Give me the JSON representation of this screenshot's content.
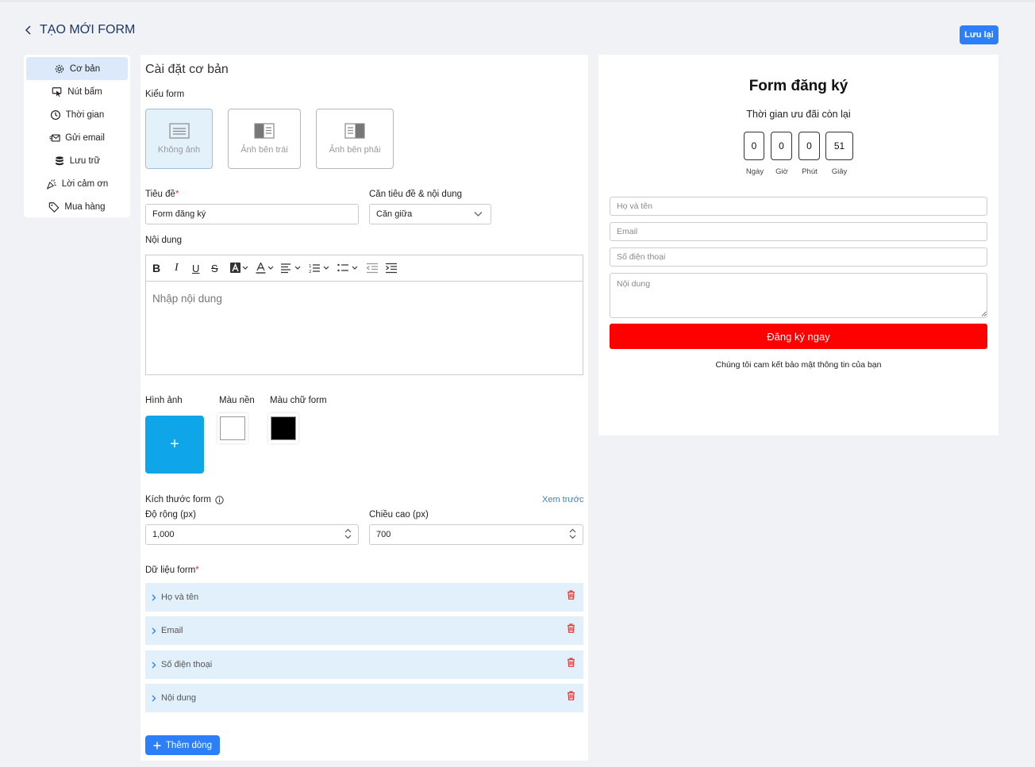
{
  "header": {
    "title": "TẠO MỚI FORM",
    "save_label": "Lưu lại"
  },
  "sidebar": {
    "items": [
      {
        "label": "Cơ bản",
        "icon": "gear-icon",
        "active": true
      },
      {
        "label": "Nút bấm",
        "icon": "pointer-click-icon"
      },
      {
        "label": "Thời gian",
        "icon": "clock-icon"
      },
      {
        "label": "Gửi email",
        "icon": "email-send-icon"
      },
      {
        "label": "Lưu trữ",
        "icon": "database-icon"
      },
      {
        "label": "Lời cảm ơn",
        "icon": "party-popper-icon"
      },
      {
        "label": "Mua hàng",
        "icon": "tag-icon"
      }
    ]
  },
  "settings": {
    "section_title": "Cài đặt cơ bản",
    "form_type_label": "Kiểu form",
    "form_types": [
      {
        "label": "Không ảnh",
        "selected": true
      },
      {
        "label": "Ảnh bên trái"
      },
      {
        "label": "Ảnh bên phải"
      }
    ],
    "title_label": "Tiêu đề",
    "title_value": "Form đăng ký",
    "align_label": "Căn tiêu đề & nội dung",
    "align_value": "Căn giữa",
    "content_label": "Nội dung",
    "content_placeholder": "Nhập nội dung",
    "image_label": "Hình ảnh",
    "bg_color_label": "Màu nền",
    "bg_color": "#ffffff",
    "text_color_label": "Màu chữ form",
    "text_color": "#000000",
    "size_label": "Kích thước form",
    "preview_link": "Xem trước",
    "width_label": "Độ rộng (px)",
    "width_value": "1,000",
    "height_label": "Chiều cao (px)",
    "height_value": "700",
    "fields_label": "Dữ liệu form",
    "fields": [
      "Họ và tên",
      "Email",
      "Số điện thoại",
      "Nội dung"
    ],
    "add_row_label": "Thêm dòng"
  },
  "preview": {
    "title": "Form đăng ký",
    "countdown_label": "Thời gian ưu đãi còn lại",
    "countdown": [
      {
        "value": "0",
        "unit": "Ngày"
      },
      {
        "value": "0",
        "unit": "Giờ"
      },
      {
        "value": "0",
        "unit": "Phút"
      },
      {
        "value": "51",
        "unit": "Giây"
      }
    ],
    "inputs": [
      "Họ và tên",
      "Email",
      "Số điện thoại"
    ],
    "textarea_placeholder": "Nội dung",
    "submit_label": "Đăng ký ngay",
    "submit_color": "#ff0000",
    "note": "Chúng tôi cam kết bảo mật thông tin của bạn"
  },
  "colors": {
    "accent": "#2d7ff9",
    "upload": "#0ea5e9",
    "field_row": "#e1f0fb",
    "delete": "#e53935"
  }
}
